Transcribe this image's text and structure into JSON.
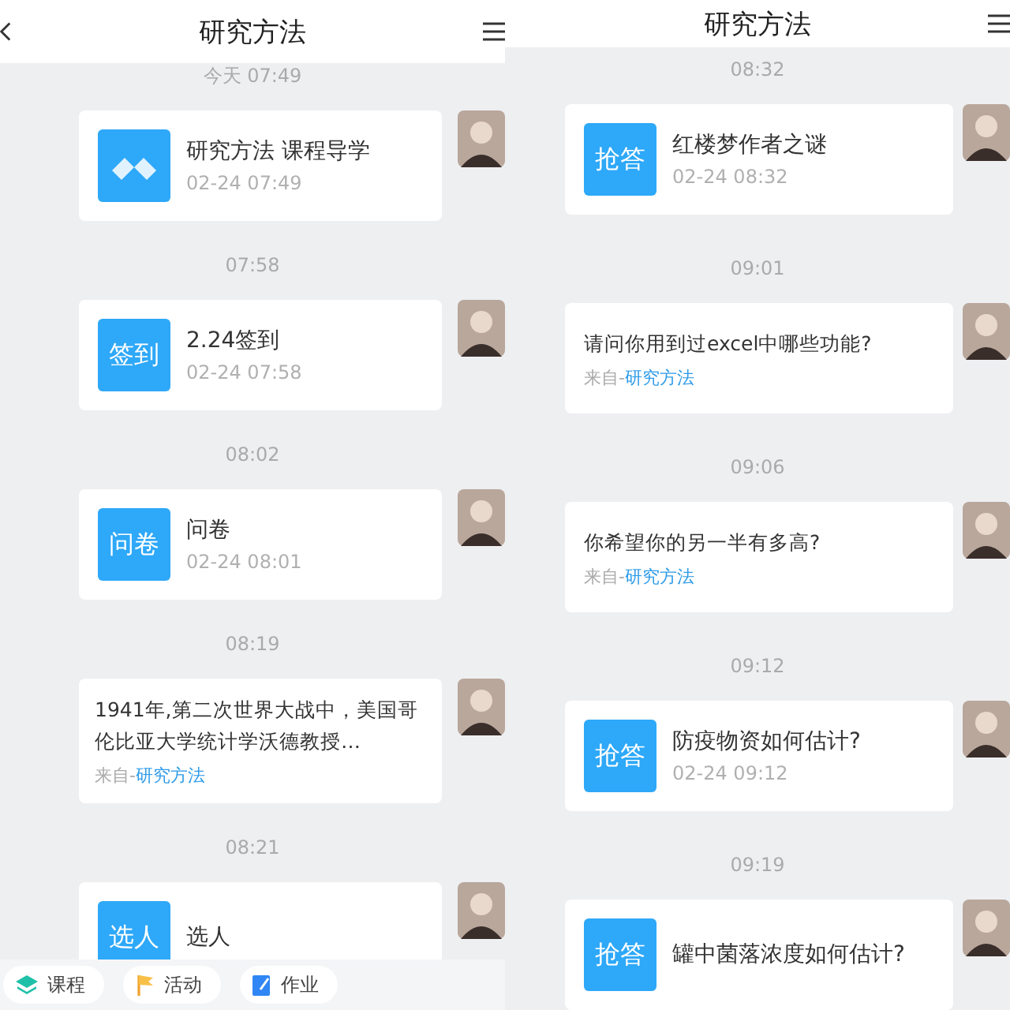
{
  "panels": [
    {
      "title": "研究方法",
      "back_button": true,
      "messages": [
        {
          "time": "今天 07:49",
          "card": {
            "kind": "activity",
            "badge": {
              "kind": "logo"
            },
            "title": "研究方法 课程导学",
            "date": "02-24 07:49"
          }
        },
        {
          "time": "07:58",
          "card": {
            "kind": "activity",
            "badge": {
              "kind": "label",
              "text": "签到"
            },
            "title": "2.24签到",
            "date": "02-24 07:58"
          }
        },
        {
          "time": "08:02",
          "card": {
            "kind": "activity",
            "badge": {
              "kind": "label",
              "text": "问卷"
            },
            "title": "问卷",
            "date": "02-24 08:01"
          }
        },
        {
          "time": "08:19",
          "card": {
            "kind": "text",
            "body": "1941年,第二次世界大战中，美国哥伦比亚大学统计学沃德教授…",
            "source_prefix": "来自-",
            "source": "研究方法"
          }
        },
        {
          "time": "08:21",
          "card": {
            "kind": "activity",
            "badge": {
              "kind": "label",
              "text": "选人"
            },
            "title": "选人"
          }
        }
      ],
      "tab_bar": [
        {
          "kind": "course",
          "label": "课程"
        },
        {
          "kind": "activity",
          "label": "活动"
        },
        {
          "kind": "homework",
          "label": "作业"
        }
      ]
    },
    {
      "title": "研究方法",
      "back_button": false,
      "messages": [
        {
          "time": "08:32",
          "card": {
            "kind": "activity",
            "badge": {
              "kind": "label",
              "text": "抢答"
            },
            "title": "红楼梦作者之谜",
            "date": "02-24 08:32"
          }
        },
        {
          "time": "09:01",
          "card": {
            "kind": "text",
            "body": "请问你用到过excel中哪些功能?",
            "source_prefix": "来自-",
            "source": "研究方法"
          }
        },
        {
          "time": "09:06",
          "card": {
            "kind": "text",
            "body": "你希望你的另一半有多高?",
            "source_prefix": "来自-",
            "source": "研究方法"
          }
        },
        {
          "time": "09:12",
          "card": {
            "kind": "activity",
            "badge": {
              "kind": "label",
              "text": "抢答"
            },
            "title": "防疫物资如何估计?",
            "date": "02-24 09:12"
          }
        },
        {
          "time": "09:19",
          "card": {
            "kind": "activity",
            "badge": {
              "kind": "label",
              "text": "抢答"
            },
            "title": "罐中菌落浓度如何估计?"
          }
        }
      ]
    }
  ]
}
